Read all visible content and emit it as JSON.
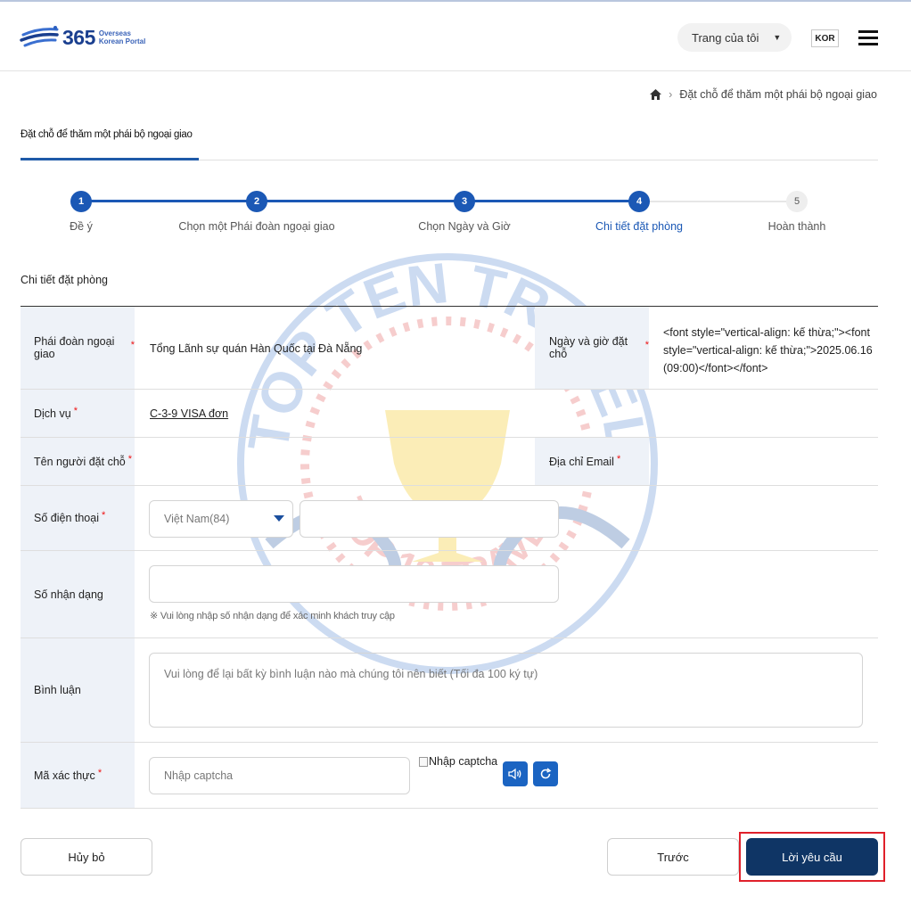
{
  "header": {
    "logo_number": "365",
    "logo_line1": "Overseas",
    "logo_line2": "Korean Portal",
    "mypage_label": "Trang của tôi",
    "language": "KOR"
  },
  "breadcrumb": {
    "current": "Đặt chỗ để thăm một phái bộ ngoại giao"
  },
  "page_tab": "Đặt chỗ để thăm một phái bộ ngoại giao",
  "steps": [
    {
      "num": "1",
      "label": "Đề ý",
      "state": "done"
    },
    {
      "num": "2",
      "label": "Chọn một Phái đoàn ngoại giao",
      "state": "done"
    },
    {
      "num": "3",
      "label": "Chọn Ngày và Giờ",
      "state": "done"
    },
    {
      "num": "4",
      "label": "Chi tiết đặt phòng",
      "state": "active"
    },
    {
      "num": "5",
      "label": "Hoàn thành",
      "state": "todo"
    }
  ],
  "section_title": "Chi tiết đặt phòng",
  "form": {
    "mission_label": "Phái đoàn ngoại giao",
    "mission_value": "Tổng Lãnh sự quán Hàn Quốc tại Đà Nẵng",
    "datetime_label": "Ngày và giờ đặt chỗ",
    "datetime_value": "<font style=\"vertical-align: kế thừa;\"><font style=\"vertical-align: kế thừa;\">2025.06.16 (09:00)</font></font>",
    "service_label": "Dịch vụ",
    "service_value": "C-3-9 VISA đơn",
    "name_label": "Tên người đặt chỗ",
    "email_label": "Địa chỉ Email",
    "phone_label": "Số điện thoại",
    "phone_country": "Việt Nam(84)",
    "id_label": "Số nhận dạng",
    "id_hint": "※ Vui lòng nhập số nhận dạng để xác minh khách truy cập",
    "comment_label": "Bình luận",
    "comment_placeholder": "Vui lòng để lại bất kỳ bình luận nào mà chúng tôi nên biết (Tối đa 100 ký tự)",
    "captcha_label": "Mã xác thực",
    "captcha_placeholder": "Nhập captcha",
    "captcha_img_alt": "Nhập captcha"
  },
  "buttons": {
    "cancel": "Hủy bỏ",
    "prev": "Trước",
    "request": "Lời yêu cầu"
  },
  "watermark": {
    "top_text": "TOP TEN TRAVEL",
    "bottom_text": "TOP 10 TRAVEL"
  },
  "colors": {
    "brand_navy": "#0f3565",
    "step_blue": "#1b58b5",
    "label_bg": "#eef2f8",
    "required": "#e11111",
    "highlight": "#e0202a"
  }
}
